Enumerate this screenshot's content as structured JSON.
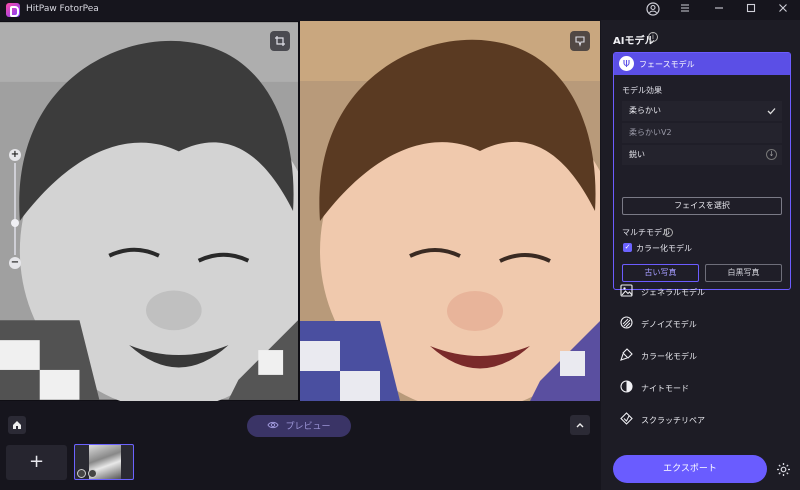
{
  "app": {
    "title": "HitPaw FotorPea"
  },
  "titlebar": {
    "account_icon": "user-circle-icon",
    "menu_icon": "hamburger-menu-icon",
    "minimize_icon": "minimize-icon",
    "maximize_icon": "maximize-icon",
    "close_icon": "close-icon"
  },
  "viewer": {
    "crop_icon": "crop-icon",
    "compare_icon": "compare-icon",
    "zoom_in": "+",
    "zoom_out": "−",
    "zoom_level": 0.35
  },
  "bottom": {
    "home_icon": "home-icon",
    "preview_label": "プレビュー",
    "collapse_icon": "chevron-up-icon",
    "add_label": "+"
  },
  "panel": {
    "title": "AIモデル",
    "face_model": {
      "label": "フェースモデル",
      "effect_label": "モデル効果",
      "options": [
        {
          "label": "柔らかい",
          "selected": true
        },
        {
          "label": "柔らかいV2",
          "selected": false
        },
        {
          "label": "鋭い",
          "selected": false
        }
      ],
      "select_face_label": "フェイスを選択",
      "multi_model_label": "マルチモデル",
      "color_model_checkbox": "カラー化モデル",
      "old_photo_label": "古い写真",
      "bw_photo_label": "白黒写真"
    },
    "models": [
      {
        "label": "ジェネラルモデル",
        "icon": "image-icon"
      },
      {
        "label": "デノイズモデル",
        "icon": "denoise-icon"
      },
      {
        "label": "カラー化モデル",
        "icon": "paint-brush-icon"
      },
      {
        "label": "ナイトモード",
        "icon": "half-moon-icon"
      },
      {
        "label": "スクラッチリペア",
        "icon": "scratch-repair-icon"
      }
    ],
    "export_label": "エクスポート",
    "settings_icon": "gear-icon"
  },
  "colors": {
    "accent": "#6a5cff",
    "background": "#16151d",
    "panel": "#1d1c25"
  }
}
